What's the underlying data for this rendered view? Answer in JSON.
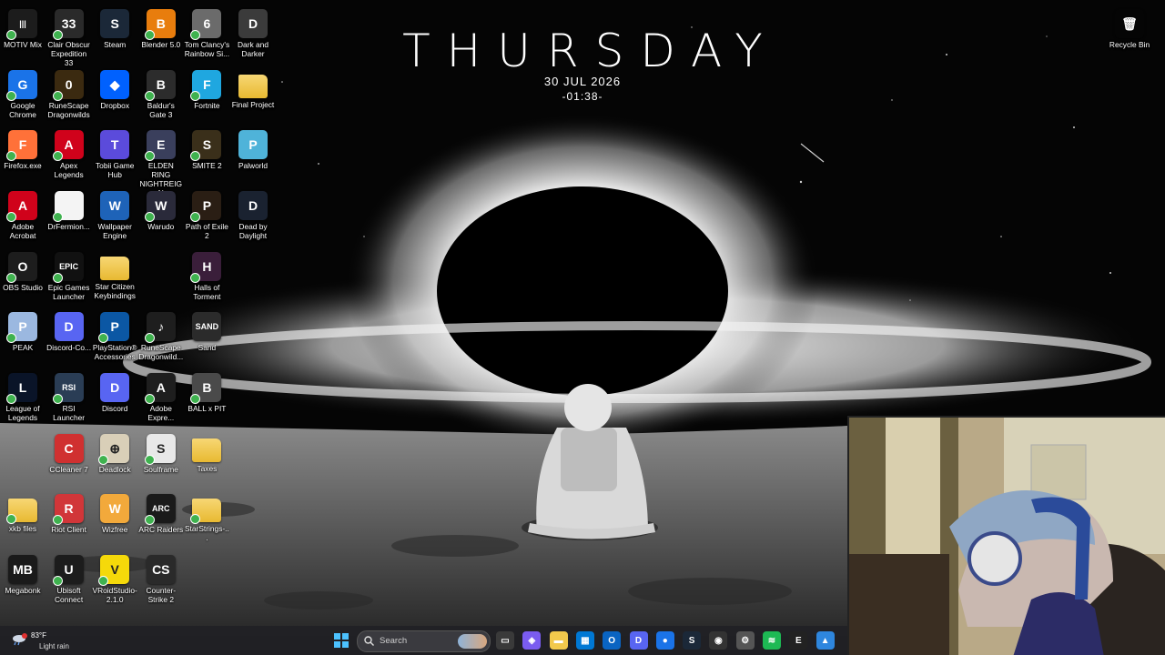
{
  "clock": {
    "day": "THURSDAY",
    "date": "30 JUL 2026",
    "time": "-01:38-"
  },
  "desktop_icons": [
    {
      "label": "MOTIV Mix",
      "color": "#1c1c1c",
      "glyph": "|||"
    },
    {
      "label": "Clair Obscur Expedition 33",
      "color": "#2a2a2a",
      "glyph": "33"
    },
    {
      "label": "Steam",
      "color": "#1b2838",
      "glyph": "S"
    },
    {
      "label": "Blender 5.0",
      "color": "#e87d0d",
      "glyph": "B"
    },
    {
      "label": "Tom Clancy's Rainbow Si...",
      "color": "#6b6b6b",
      "glyph": "6"
    },
    {
      "label": "Dark and Darker",
      "color": "#3b3b3b",
      "glyph": "D"
    },
    {
      "label": "Google Chrome",
      "color": "#1a73e8",
      "glyph": "G"
    },
    {
      "label": "RuneScape Dragonwilds",
      "color": "#3b2a10",
      "glyph": "0"
    },
    {
      "label": "Dropbox",
      "color": "#0061fe",
      "glyph": "◆"
    },
    {
      "label": "Baldur's Gate 3",
      "color": "#2c2c2c",
      "glyph": "B"
    },
    {
      "label": "Fortnite",
      "color": "#1fa7e0",
      "glyph": "F"
    },
    {
      "label": "Final Project",
      "color": "#f2c94c",
      "glyph": ""
    },
    {
      "label": "Firefox.exe",
      "color": "#ff7139",
      "glyph": "F"
    },
    {
      "label": "Apex Legends",
      "color": "#d0021b",
      "glyph": "A"
    },
    {
      "label": "Tobii Game Hub",
      "color": "#5b4bdb",
      "glyph": "T"
    },
    {
      "label": "ELDEN RING NIGHTREIGN",
      "color": "#3a3f5c",
      "glyph": "E"
    },
    {
      "label": "SMITE 2",
      "color": "#3a2f1a",
      "glyph": "S"
    },
    {
      "label": "Palworld",
      "color": "#4fb3d9",
      "glyph": "P"
    },
    {
      "label": "Adobe Acrobat",
      "color": "#d0021b",
      "glyph": "A"
    },
    {
      "label": "DrFermion...",
      "color": "#f4f4f4",
      "glyph": ""
    },
    {
      "label": "Wallpaper Engine",
      "color": "#1e63b8",
      "glyph": "W"
    },
    {
      "label": "Warudo",
      "color": "#2a2a3a",
      "glyph": "W"
    },
    {
      "label": "Path of Exile 2",
      "color": "#2a1e14",
      "glyph": "P"
    },
    {
      "label": "Dead by Daylight",
      "color": "#1a2230",
      "glyph": "D"
    },
    {
      "label": "OBS Studio",
      "color": "#1d1d1d",
      "glyph": "O"
    },
    {
      "label": "Epic Games Launcher",
      "color": "#111111",
      "glyph": "EPIC"
    },
    {
      "label": "Star Citizen Keybindings",
      "color": "#f2c94c",
      "glyph": ""
    },
    {
      "label": "Halls of Torment",
      "color": "#3a1e3a",
      "glyph": "H"
    },
    {
      "label": "PEAK",
      "color": "#9bb8e0",
      "glyph": "P"
    },
    {
      "label": "Discord-Co...",
      "color": "#5865f2",
      "glyph": "D"
    },
    {
      "label": "PlayStation® Accessories",
      "color": "#0b57a4",
      "glyph": "P"
    },
    {
      "label": "RuneScape Dragonwild...",
      "color": "#1e1e1e",
      "glyph": "♪"
    },
    {
      "label": "Sand",
      "color": "#2b2b2b",
      "glyph": "SAND"
    },
    {
      "label": "League of Legends",
      "color": "#0a1428",
      "glyph": "L"
    },
    {
      "label": "RSI Launcher",
      "color": "#2a3d55",
      "glyph": "RSI"
    },
    {
      "label": "Discord",
      "color": "#5865f2",
      "glyph": "D"
    },
    {
      "label": "Adobe Expre...",
      "color": "#1e1e1e",
      "glyph": "A"
    },
    {
      "label": "BALL x PIT",
      "color": "#4a4a4a",
      "glyph": "B"
    },
    {
      "label": "CCleaner 7",
      "color": "#d03030",
      "glyph": "C"
    },
    {
      "label": "Deadlock",
      "color": "#d9cfb8",
      "glyph": "⊕"
    },
    {
      "label": "Soulframe",
      "color": "#e8e8e8",
      "glyph": "S"
    },
    {
      "label": "Taxes",
      "color": "#f2c94c",
      "glyph": ""
    },
    {
      "label": "xkb files",
      "color": "#f2c94c",
      "glyph": ""
    },
    {
      "label": "Riot Client",
      "color": "#d13639",
      "glyph": "R"
    },
    {
      "label": "Wizfree",
      "color": "#f2a93b",
      "glyph": "W"
    },
    {
      "label": "ARC Raiders",
      "color": "#1a1a1a",
      "glyph": "ARC"
    },
    {
      "label": "StarStrings-...",
      "color": "#f2c94c",
      "glyph": ""
    },
    {
      "label": "Megabonk",
      "color": "#1a1a1a",
      "glyph": "MB"
    },
    {
      "label": "Ubisoft Connect",
      "color": "#1c1c1c",
      "glyph": "U"
    },
    {
      "label": "VRoidStudio-2.1.0",
      "color": "#f5d90a",
      "glyph": "V"
    },
    {
      "label": "Counter-Strike 2",
      "color": "#2a2a2a",
      "glyph": "CS"
    },
    {
      "label": "Recycle Bin",
      "color": "transparent",
      "glyph": "🗑"
    }
  ],
  "taskbar": {
    "weather": {
      "temp": "83°F",
      "condition": "Light rain",
      "badge": "1"
    },
    "search_placeholder": "Search",
    "pinned": [
      {
        "name": "task-view",
        "color": "#3a3a3a",
        "glyph": "▭"
      },
      {
        "name": "copilot",
        "color": "#7a5cf0",
        "glyph": "◈"
      },
      {
        "name": "file-explorer",
        "color": "#f2c94c",
        "glyph": "▬"
      },
      {
        "name": "ms-store",
        "color": "#0078d4",
        "glyph": "▦"
      },
      {
        "name": "outlook",
        "color": "#0a64c2",
        "glyph": "O"
      },
      {
        "name": "discord",
        "color": "#5865f2",
        "glyph": "D"
      },
      {
        "name": "chrome",
        "color": "#1a73e8",
        "glyph": "●"
      },
      {
        "name": "steam",
        "color": "#1b2838",
        "glyph": "S"
      },
      {
        "name": "obs",
        "color": "#333333",
        "glyph": "◉"
      },
      {
        "name": "settings",
        "color": "#555555",
        "glyph": "⚙"
      },
      {
        "name": "spotify",
        "color": "#1db954",
        "glyph": "≋"
      },
      {
        "name": "epic-games",
        "color": "#222222",
        "glyph": "E"
      },
      {
        "name": "photos",
        "color": "#2e86de",
        "glyph": "▲"
      }
    ]
  }
}
